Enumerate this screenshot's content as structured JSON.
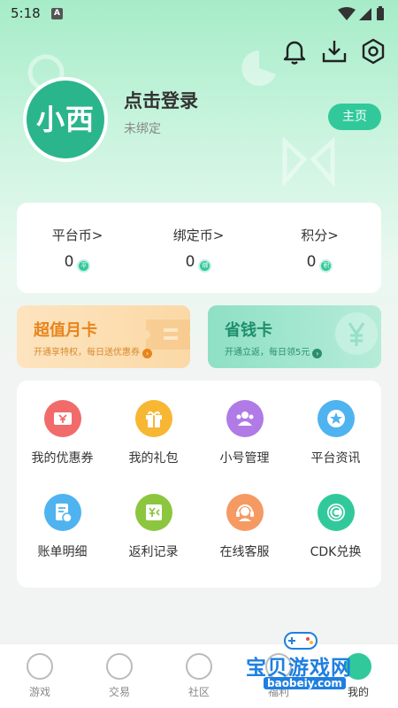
{
  "status_bar": {
    "time": "5:18",
    "notif_letter": "A"
  },
  "header": {
    "icons": [
      "bell-icon",
      "download-icon",
      "settings-hexagon-icon"
    ]
  },
  "profile": {
    "avatar_text": "小西",
    "login_title": "点击登录",
    "bind_status": "未绑定",
    "home_button": "主页"
  },
  "balances": [
    {
      "label": "平台币",
      "chevron": ">",
      "value": "0",
      "coin_text": "平"
    },
    {
      "label": "绑定币",
      "chevron": ">",
      "value": "0",
      "coin_text": "绑"
    },
    {
      "label": "积分",
      "chevron": ">",
      "value": "0",
      "coin_text": "积"
    }
  ],
  "promos": {
    "month_card": {
      "title": "超值月卡",
      "subtitle": "开通享特权，每日送优惠券"
    },
    "save_card": {
      "title": "省钱卡",
      "subtitle": "开通立返，每日领5元"
    }
  },
  "services": [
    {
      "label": "我的优惠券",
      "icon": "coupon-yen-icon",
      "color": "#f26b6b"
    },
    {
      "label": "我的礼包",
      "icon": "gift-icon",
      "color": "#f7b733"
    },
    {
      "label": "小号管理",
      "icon": "accounts-group-icon",
      "color": "#b07be6"
    },
    {
      "label": "平台资讯",
      "icon": "star-news-icon",
      "color": "#4fb3f0"
    },
    {
      "label": "账单明细",
      "icon": "bill-icon",
      "color": "#4fb3f0"
    },
    {
      "label": "返利记录",
      "icon": "rebate-icon",
      "color": "#8cc63f"
    },
    {
      "label": "在线客服",
      "icon": "headset-icon",
      "color": "#f59a63"
    },
    {
      "label": "CDK兑换",
      "icon": "cdk-copyright-icon",
      "color": "#31c99b"
    }
  ],
  "bottom_nav": [
    {
      "label": "游戏",
      "icon": "gamepad-icon"
    },
    {
      "label": "交易",
      "icon": "exchange-icon"
    },
    {
      "label": "社区",
      "icon": "planet-icon"
    },
    {
      "label": "福利",
      "icon": "gift-icon"
    },
    {
      "label": "我的",
      "icon": "user-icon"
    }
  ],
  "watermark": {
    "text": "宝贝游戏网",
    "url": "baobeiy.com"
  },
  "colors": {
    "accent": "#31c99b",
    "orange": "#e8841c"
  }
}
